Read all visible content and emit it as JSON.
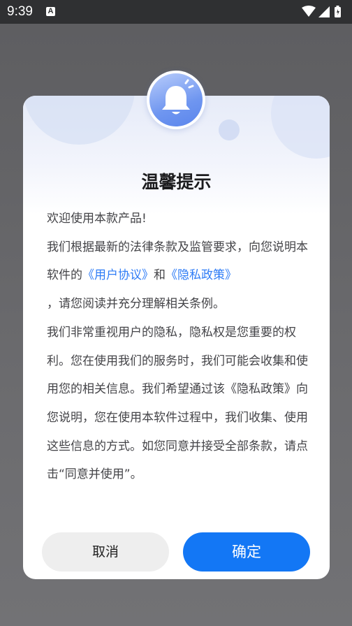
{
  "status_bar": {
    "time": "9:39",
    "notification_icon": "A"
  },
  "dialog": {
    "icon": "bell-icon",
    "title": "温馨提示",
    "content": {
      "greeting": "欢迎使用本款产品!",
      "line2_prefix": "我们根据最新的法律条款及监管要求，向您说明本软件的",
      "user_agreement_link": "《用户协议》",
      "and": "和",
      "privacy_policy_link": "《隐私政策》",
      "line2_suffix": "，请您阅读并充分理解相关条例。",
      "paragraph": "我们非常重视用户的隐私，隐私权是您重要的权利。您在使用我们的服务时，我们可能会收集和使用您的相关信息。我们希望通过该《隐私政策》向您说明，您在使用本软件过程中，我们收集、使用这些信息的方式。如您同意并接受全部条款，请点击“同意并使用”。"
    },
    "buttons": {
      "cancel": "取消",
      "confirm": "确定"
    }
  },
  "colors": {
    "accent": "#1377f5",
    "link": "#2e7cf6",
    "overlay": "#6b6b6e"
  }
}
